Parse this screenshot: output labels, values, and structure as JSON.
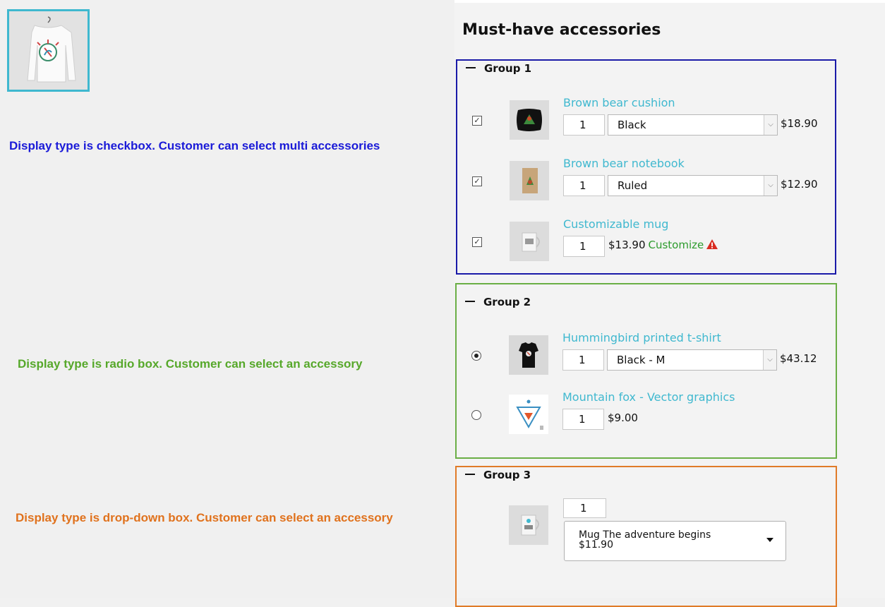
{
  "heading": "Must-have accessories",
  "notes": [
    {
      "text": "Display type is checkbox. Customer can select multi accessories",
      "color": "#1a1ad8"
    },
    {
      "text": "Display type is radio box. Customer can select an accessory",
      "color": "#56a82a"
    },
    {
      "text": "Display type is drop-down box. Customer can select an accessory",
      "color": "#e0721d"
    }
  ],
  "colors": {
    "group_1_border": "#1a1aa8",
    "group_2_border": "#6aae45",
    "group_3_border": "#e07b28",
    "product_link": "#3fb8cf",
    "customize": "#2c9b2c",
    "warning": "#d92b20"
  },
  "groups": [
    {
      "legend": "Group 1",
      "display_type": "checkbox",
      "items": [
        {
          "name": "Brown bear cushion",
          "qty": "1",
          "variant": "Black",
          "price": "$18.90",
          "checked": true,
          "icon": "cushion-image"
        },
        {
          "name": "Brown bear notebook",
          "qty": "1",
          "variant": "Ruled",
          "price": "$12.90",
          "checked": true,
          "icon": "notebook-image"
        },
        {
          "name": "Customizable mug",
          "qty": "1",
          "price": "$13.90",
          "customize": "Customize",
          "checked": true,
          "icon": "mug-image",
          "warning_icon": "warning-icon"
        }
      ]
    },
    {
      "legend": "Group 2",
      "display_type": "radio",
      "items": [
        {
          "name": "Hummingbird printed t-shirt",
          "qty": "1",
          "variant": "Black - M",
          "price": "$43.12",
          "selected": true,
          "icon": "tshirt-image"
        },
        {
          "name": "Mountain fox - Vector graphics",
          "qty": "1",
          "price": "$9.00",
          "selected": false,
          "icon": "vector-graphic-image"
        }
      ]
    },
    {
      "legend": "Group 3",
      "display_type": "dropdown",
      "qty": "1",
      "selected_option": {
        "name": "Mug The adventure begins",
        "price": "$11.90"
      },
      "icon": "mug-image"
    }
  ]
}
